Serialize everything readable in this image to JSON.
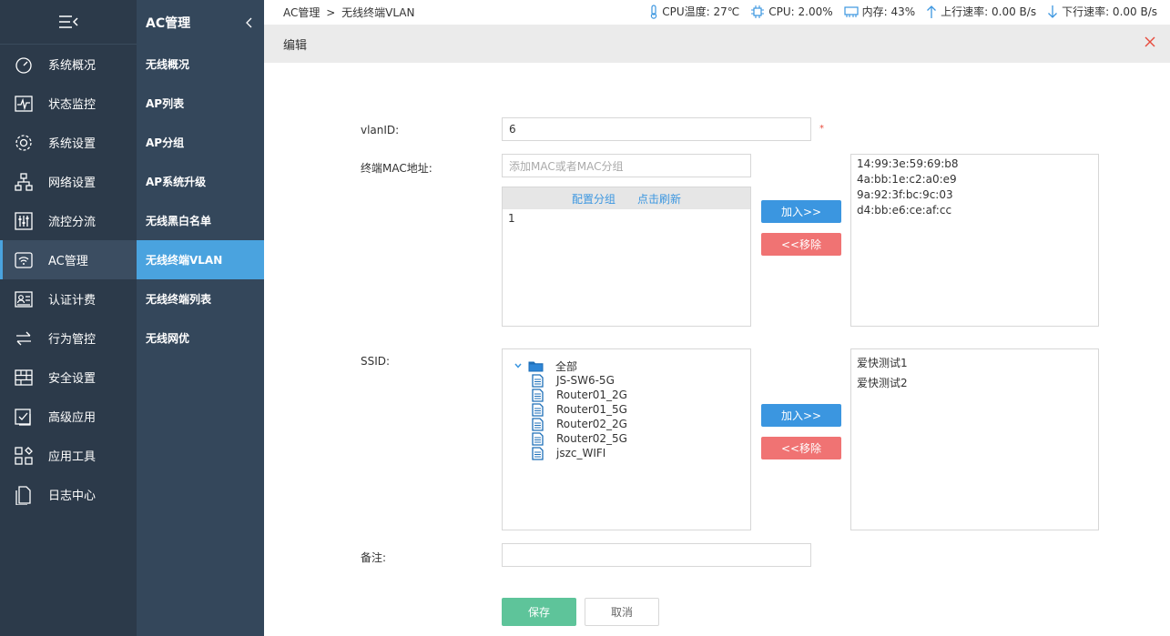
{
  "sidebar": {
    "items": [
      {
        "label": "系统概况",
        "icon": "dashboard-icon"
      },
      {
        "label": "状态监控",
        "icon": "monitor-icon"
      },
      {
        "label": "系统设置",
        "icon": "gear-icon"
      },
      {
        "label": "网络设置",
        "icon": "network-icon"
      },
      {
        "label": "流控分流",
        "icon": "sliders-icon"
      },
      {
        "label": "AC管理",
        "icon": "wifi-router-icon"
      },
      {
        "label": "认证计费",
        "icon": "id-card-icon"
      },
      {
        "label": "行为管控",
        "icon": "arrows-icon"
      },
      {
        "label": "安全设置",
        "icon": "firewall-icon"
      },
      {
        "label": "高级应用",
        "icon": "checklist-icon"
      },
      {
        "label": "应用工具",
        "icon": "tools-icon"
      },
      {
        "label": "日志中心",
        "icon": "document-icon"
      }
    ]
  },
  "submenu": {
    "title": "AC管理",
    "items": [
      "无线概况",
      "AP列表",
      "AP分组",
      "AP系统升级",
      "无线黑白名单",
      "无线终端VLAN",
      "无线终端列表",
      "无线网优"
    ]
  },
  "breadcrumb": {
    "parent": "AC管理",
    "sep": ">",
    "current": "无线终端VLAN"
  },
  "stats": {
    "cpu_temp": "CPU温度: 27℃",
    "cpu": "CPU: 2.00%",
    "mem": "内存: 43%",
    "up": "上行速率: 0.00 B/s",
    "down": "下行速率: 0.00 B/s"
  },
  "dialog": {
    "title": "编辑"
  },
  "form": {
    "vlan_label": "vlanID:",
    "vlan_value": "6",
    "required_mark": "*",
    "mac_label": "终端MAC地址:",
    "mac_placeholder": "添加MAC或者MAC分组",
    "config_group": "配置分组",
    "refresh": "点击刷新",
    "mac_list_items": [
      "1"
    ],
    "add_label": "加入>>",
    "remove_label": "<<移除",
    "selected_macs": [
      "14:99:3e:59:69:b8",
      "4a:bb:1e:c2:a0:e9",
      "9a:92:3f:bc:9c:03",
      "d4:bb:e6:ce:af:cc"
    ],
    "ssid_label": "SSID:",
    "ssid_tree": {
      "root": "全部",
      "children": [
        "JS-SW6-5G",
        "Router01_2G",
        "Router01_5G",
        "Router02_2G",
        "Router02_5G",
        "jszc_WIFI"
      ]
    },
    "selected_ssids": [
      "爱快测试1",
      "爱快测试2"
    ],
    "note_label": "备注:",
    "note_value": "",
    "save": "保存",
    "cancel": "取消"
  },
  "colors": {
    "accent": "#4aa3df",
    "sidebar": "#2c3a4a",
    "submenu": "#34475b",
    "save": "#5ec49a",
    "remove": "#f07373"
  }
}
